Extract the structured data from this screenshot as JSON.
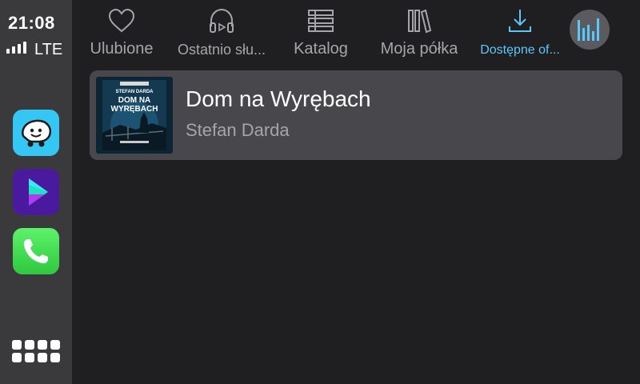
{
  "status": {
    "time": "21:08",
    "network": "LTE"
  },
  "dock": {
    "apps": [
      {
        "name": "Waze",
        "icon": "waze-icon"
      },
      {
        "name": "Audiobook player",
        "icon": "play-triangle-icon"
      },
      {
        "name": "Phone",
        "icon": "phone-icon"
      }
    ],
    "launcher_icon": "app-grid-icon"
  },
  "tabs": [
    {
      "label": "Ulubione",
      "icon": "heart-icon",
      "active": false
    },
    {
      "label": "Ostatnio słu...",
      "icon": "headphones-icon",
      "active": false
    },
    {
      "label": "Katalog",
      "icon": "list-icon",
      "active": false
    },
    {
      "label": "Moja półka",
      "icon": "bookshelf-icon",
      "active": false
    },
    {
      "label": "Dostępne of...",
      "icon": "download-icon",
      "active": true
    }
  ],
  "now_playing_icon": "equalizer-icon",
  "list": [
    {
      "title": "Dom na Wyrębach",
      "author": "Stefan Darda",
      "cover": {
        "author_text": "STEFAN DARDA",
        "title_text": "DOM NA WYRĘBACH"
      }
    }
  ],
  "colors": {
    "accent": "#5ac8fa",
    "background": "#1f1f21",
    "dock": "#3a3a3c",
    "row": "#48484c"
  }
}
